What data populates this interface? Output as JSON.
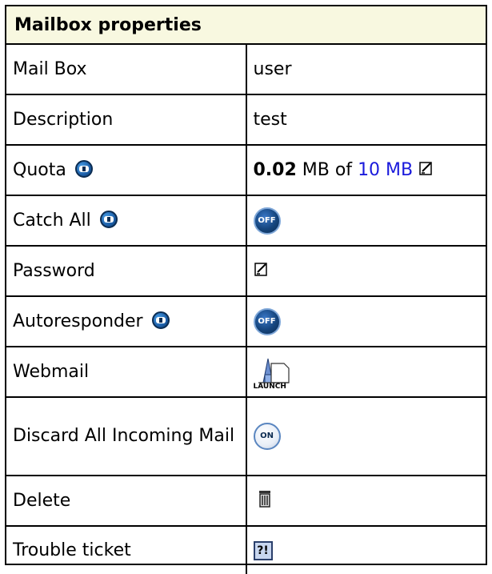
{
  "title": "Mailbox properties",
  "rows": {
    "mailbox": {
      "label": "Mail Box",
      "value": "user"
    },
    "description": {
      "label": "Description",
      "value": "test"
    },
    "quota": {
      "label": "Quota",
      "used": "0.02",
      "used_unit": "MB of",
      "limit": "10 MB"
    },
    "catch_all": {
      "label": "Catch All",
      "state": "OFF"
    },
    "password": {
      "label": "Password"
    },
    "autoresponder": {
      "label": "Autoresponder",
      "state": "OFF"
    },
    "webmail": {
      "label": "Webmail",
      "button": "LAUNCH"
    },
    "discard": {
      "label": "Discard All Incoming Mail",
      "state": "ON"
    },
    "delete": {
      "label": "Delete"
    },
    "ticket": {
      "label": "Trouble ticket",
      "icon_text": "?!"
    }
  },
  "icons": {
    "help": "help-icon",
    "edit": "edit-icon",
    "trash": "trash-icon",
    "launch": "launch-icon",
    "ticket": "trouble-ticket-icon"
  },
  "colors": {
    "header_bg": "#f8f8e0",
    "link": "#1a1adc",
    "toggle_off": "#15457d"
  }
}
